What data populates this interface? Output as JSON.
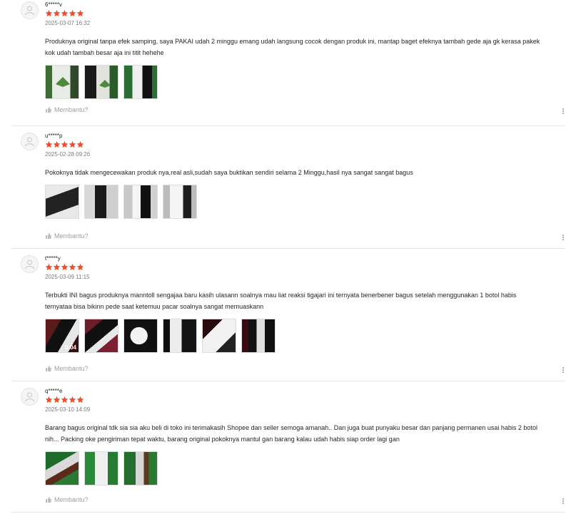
{
  "helpful_label": "Membantu?",
  "star_color": "#ee4d2d",
  "reviews": [
    {
      "username": "6*****v",
      "rating": 5,
      "date": "2025-03-07 16:32",
      "text": "Produknya original tanpa efek samping, saya PAKAI udah 2 minggu emang udah langsung cocok dengan produk ini, mantap baget efeknya tambah gede aja gk kerasa pakek\nkok udah tambah besar aja ini titit hehehe",
      "media_count": 3
    },
    {
      "username": "u*****p",
      "rating": 5,
      "date": "2025-02-28 09:26",
      "text": "Pokoknya tidak mengecewakan produk nya,real asli,sudah saya buktikan sendiri selama 2 Minggu,hasil nya sangat sangat bagus",
      "media_count": 4
    },
    {
      "username": "t*****y",
      "rating": 5,
      "date": "2025-03-09 11:15",
      "text": "Terbukti INI bagus produknya manntoll sengajaa baru kasih ulasann soalnya mau liat reaksi tigajari ini ternyata benerbener bagus setelah menggunakan 1 botol habis\nternyataa bisa bikinn pede saat ketemuu pacar soalnya sangat memuaskann",
      "media_count": 6,
      "video_duration": "0:04"
    },
    {
      "username": "q*****e",
      "rating": 5,
      "date": "2025-03-10 14:09",
      "text": "Barang bagus original tdk sia sia aku beli di toko ini terimakasih Shopee dan seller semoga amanah.. Dan juga buat punyaku besar dan panjang permanen usai habis 2 botol\nnih... Packing oke pengiriman tepat waktu, barang original pokoknya mantul gan barang kalau udah habis siap order lagi gan",
      "media_count": 3
    }
  ]
}
